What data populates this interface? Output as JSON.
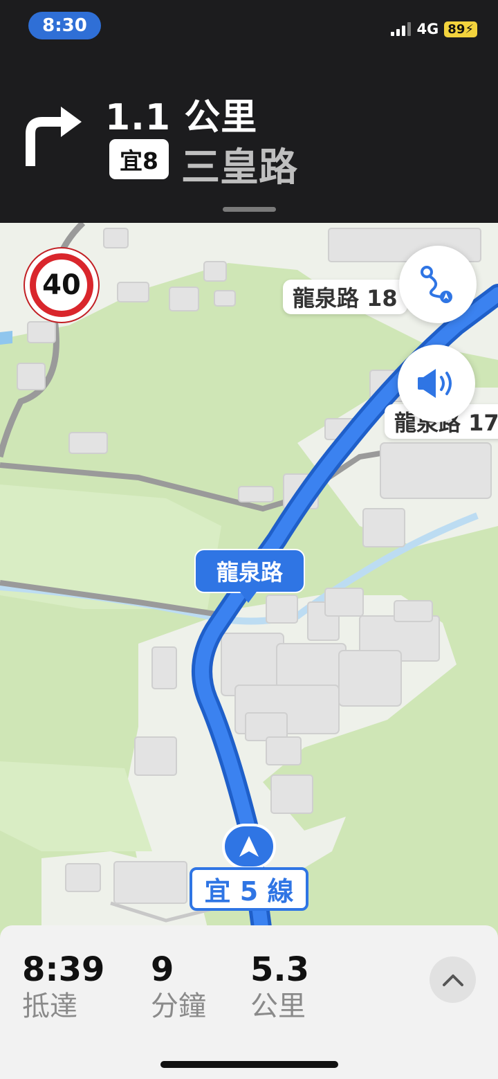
{
  "status_bar": {
    "time": "8:30",
    "network": "4G",
    "battery": "89"
  },
  "guidance": {
    "distance": "1.1 公里",
    "road_badge": "宜8",
    "road_name": "三皇路",
    "turn_icon": "turn-right-arrow-icon"
  },
  "map": {
    "speed_limit": "40",
    "labels": {
      "longquan_18": "龍泉路 18",
      "longquan_17": "龍泉路 17",
      "current_road": "龍泉路"
    },
    "route_shield": "宜 5 線",
    "buttons": {
      "route_overview_icon": "route-icon",
      "audio_icon": "speaker-icon"
    }
  },
  "trip": {
    "arrival_value": "8:39",
    "arrival_label": "抵達",
    "minutes_value": "9",
    "minutes_label": "分鐘",
    "distance_value": "5.3",
    "distance_label": "公里"
  },
  "colors": {
    "route_blue": "#2f75e4",
    "map_green": "#cfe6b6",
    "panel_dark": "#1c1c1e"
  }
}
